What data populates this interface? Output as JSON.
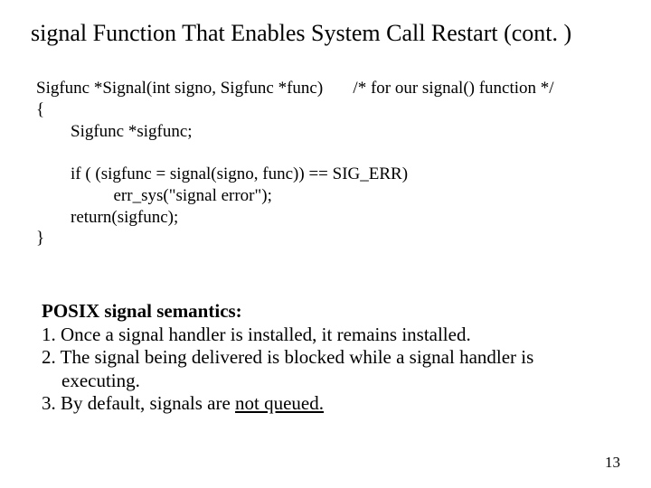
{
  "title": "signal Function That Enables System Call Restart (cont. )",
  "code": {
    "l1a": "Sigfunc *Signal(int signo, Sigfunc *func)",
    "l1b": "/* for our signal() function */",
    "l2": "{",
    "l3": "        Sigfunc *sigfunc;",
    "l4": "",
    "l5": "        if ( (sigfunc = signal(signo, func)) == SIG_ERR)",
    "l6": "                  err_sys(\"signal error\");",
    "l7": "        return(sigfunc);",
    "l8": "}"
  },
  "notes": {
    "heading": "POSIX signal semantics:",
    "n1": "1. Once a signal handler is installed, it remains installed.",
    "n2a": "2. The signal being delivered is blocked while a signal handler is",
    "n2b": "executing.",
    "n3a": "3. By default, signals are ",
    "n3b": "not queued."
  },
  "page_number": "13"
}
